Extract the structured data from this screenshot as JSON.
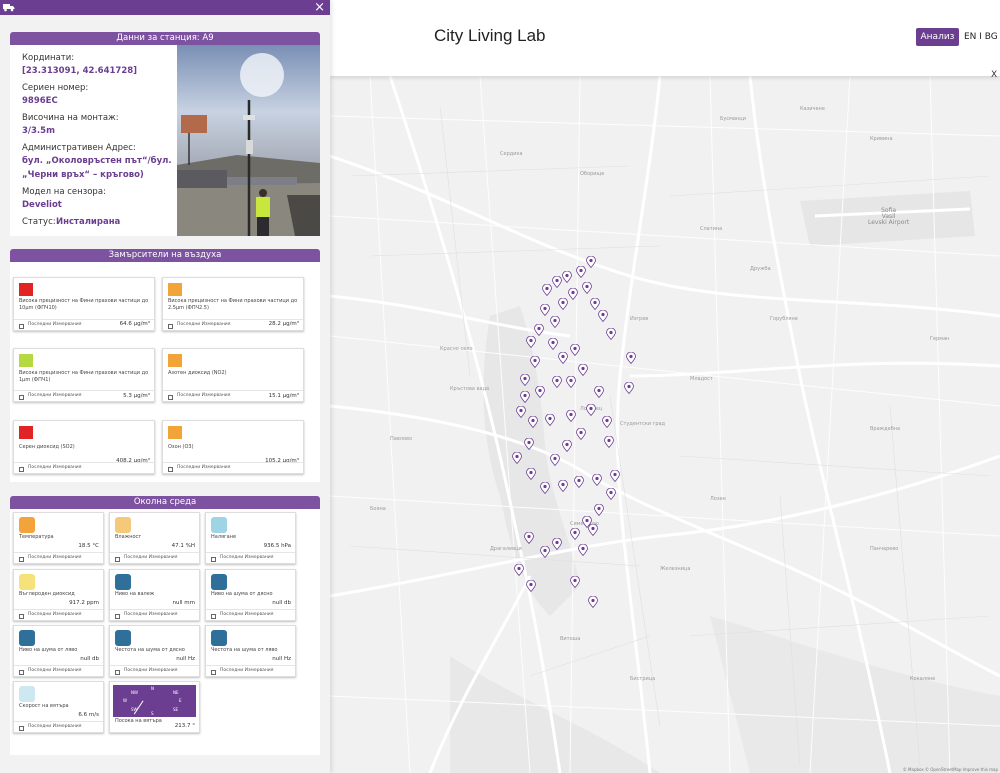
{
  "header": {
    "title": "City Living Lab",
    "analysis_button": "Анализ",
    "language": "EN I BG",
    "map_close": "X"
  },
  "sidebar": {
    "close": "×"
  },
  "station": {
    "header": "Данни за станция: A9",
    "fields": [
      {
        "label": "Кординати:",
        "value": "[23.313091, 42.641728]"
      },
      {
        "label": "Сериен номер:",
        "value": "9896EC"
      },
      {
        "label": "Височина на монтаж:",
        "value": "3/3.5m"
      },
      {
        "label": "Административен Адрес:",
        "value_lines": [
          "бул. „Околовръстен път“/бул.",
          "„Черни връх“ – кръгово)"
        ]
      },
      {
        "label": "Модел на сензора:",
        "value": "Develiot"
      }
    ],
    "status_label": "Статус:",
    "status_value": "Инсталирана"
  },
  "air": {
    "header": "Замърсители на въздуха",
    "footer": "Последни Измервания",
    "cards": [
      {
        "name": "Висока прецизност на Фини прахови частици до 10µm (ФПЧ10)",
        "value": "64.6 µg/m³",
        "color": "#e02424"
      },
      {
        "name": "Висока прецизност на Фини прахови частици до 2.5µm (ФПЧ2.5)",
        "value": "28.2 µg/m³",
        "color": "#f2a33a"
      },
      {
        "name": "Висока прецизност на Фини прахови частици до 1µm (ФПЧ1)",
        "value": "5.3 µg/m³",
        "color": "#b5d941"
      },
      {
        "name": "Азотен диоксид (NO2)",
        "value": "15.1 µg/m³",
        "color": "#f2a33a"
      },
      {
        "name": "Серен диоксид (SO2)",
        "value": "408.2 µg/m³",
        "color": "#e02424"
      },
      {
        "name": "Озон (O3)",
        "value": "105.2 µg/m³",
        "color": "#f2a33a"
      }
    ]
  },
  "env": {
    "header": "Околна среда",
    "footer": "Последни Измервания",
    "cards": [
      {
        "name": "Температура",
        "value": "18.5 °C",
        "icon": "thermometer-icon",
        "color": "#f2a33a"
      },
      {
        "name": "Влажност",
        "value": "47.1 %H",
        "icon": "humidity-icon",
        "color": "#f5c97a"
      },
      {
        "name": "Налягане",
        "value": "936.5 hPa",
        "icon": "pressure-icon",
        "color": "#9fd4e6"
      },
      {
        "name": "Въглероден диоксид",
        "value": "917.2 ppm",
        "icon": "co2-icon",
        "color": "#f5e27a"
      },
      {
        "name": "Ниво на валеж",
        "value": "null mm",
        "icon": "rain-icon",
        "color": "#2f6f9a"
      },
      {
        "name": "Ниво на шума от дясно",
        "value": "null db",
        "icon": "ear-icon",
        "color": "#2f6f9a"
      },
      {
        "name": "Ниво на шума от ляво",
        "value": "null db",
        "icon": "ear-icon",
        "color": "#2f6f9a"
      },
      {
        "name": "Честота на шума от дясно",
        "value": "null Hz",
        "icon": "ear-icon",
        "color": "#2f6f9a"
      },
      {
        "name": "Честота на шума от ляво",
        "value": "null Hz",
        "icon": "ear-icon",
        "color": "#2f6f9a"
      },
      {
        "name": "Скорост на вятъра",
        "value": "6.6 m/s",
        "icon": "wind-icon",
        "color": "#cde8f0"
      },
      {
        "name": "Посока на вятъра",
        "value": "213.7 °",
        "icon": "compass-icon",
        "color": "#6b3e91"
      }
    ]
  },
  "compass": {
    "n": "N",
    "s": "S",
    "e": "E",
    "w": "W",
    "ne": "NE",
    "nw": "NW",
    "se": "SE",
    "sw": "SW"
  },
  "map": {
    "airport": [
      "Sofia",
      "Vasil",
      "Levski Airport"
    ],
    "labels": [
      "Сердика",
      "Оборище",
      "Изгрев",
      "Младост",
      "Лозенец",
      "Студентски град",
      "Дружба",
      "Горубляне",
      "Бояна",
      "Симеоново",
      "Драгалевци",
      "Павлово",
      "Красно село",
      "Слатина",
      "Кръстова вада",
      "Витоша",
      "Бистрица",
      "Железница",
      "Панчарево",
      "Кокаляне",
      "Враждебна",
      "Казичене",
      "Кривина",
      "Бусманци",
      "Лозен",
      "Герман"
    ],
    "attribution": "© Mapbox © OpenStreetMap Improve this map"
  }
}
